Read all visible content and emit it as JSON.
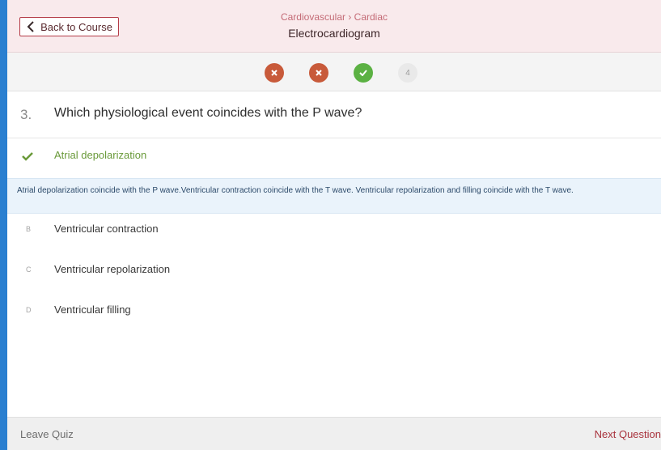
{
  "header": {
    "back_label": "Back to Course",
    "breadcrumb": "Cardiovascular › Cardiac",
    "topic": "Electrocardiogram"
  },
  "progress": [
    {
      "state": "incorrect",
      "icon": "x-icon"
    },
    {
      "state": "incorrect",
      "icon": "x-icon"
    },
    {
      "state": "correct",
      "icon": "check-icon"
    },
    {
      "state": "pending",
      "label": "4"
    }
  ],
  "question": {
    "number": "3.",
    "text": "Which physiological event coincides with the P wave?"
  },
  "correct_answer": {
    "label": "Atrial depolarization"
  },
  "explanation": "Atrial depolarization coincide with the P wave.Ventricular contraction coincide with the T wave. Ventricular repolarization and filling coincide with the T wave.",
  "options": [
    {
      "letter": "B",
      "label": "Ventricular contraction"
    },
    {
      "letter": "C",
      "label": "Ventricular repolarization"
    },
    {
      "letter": "D",
      "label": "Ventricular filling"
    }
  ],
  "footer": {
    "leave_label": "Leave Quiz",
    "next_label": "Next Question"
  },
  "colors": {
    "brand": "#b43b47",
    "incorrect": "#c85a3a",
    "correct": "#5bb143",
    "frame": "#2a7fd0"
  }
}
